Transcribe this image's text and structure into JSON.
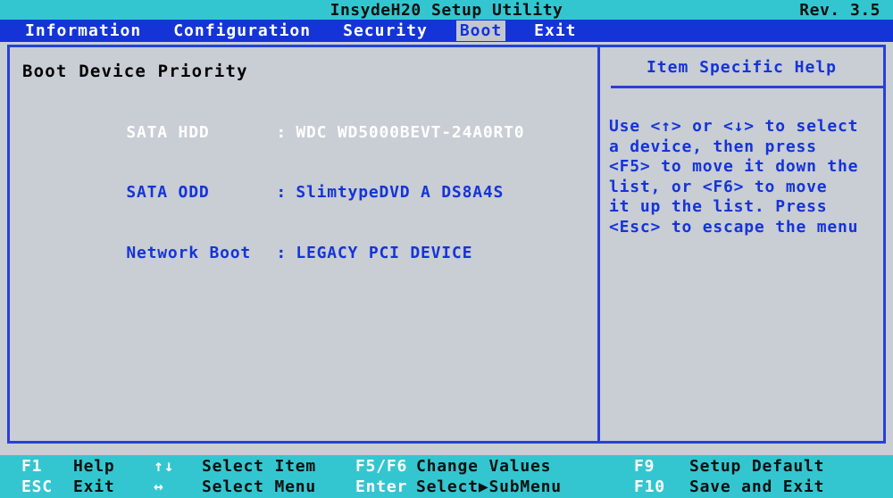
{
  "titlebar": {
    "title": "InsydeH20 Setup Utility",
    "rev": "Rev. 3.5"
  },
  "menu": {
    "items": [
      {
        "label": "Information",
        "active": false
      },
      {
        "label": "Configuration",
        "active": false
      },
      {
        "label": "Security",
        "active": false
      },
      {
        "label": "Boot",
        "active": true
      },
      {
        "label": "Exit",
        "active": false
      }
    ]
  },
  "main": {
    "section_title": "Boot Device Priority",
    "devices": [
      {
        "name": "SATA HDD",
        "colon": ":",
        "value": "WDC WD5000BEVT-24A0RT0",
        "selected": true
      },
      {
        "name": "SATA ODD",
        "colon": ":",
        "value": "SlimtypeDVD A DS8A4S",
        "selected": false
      },
      {
        "name": "Network Boot",
        "colon": ":",
        "value": "LEGACY PCI DEVICE",
        "selected": false
      }
    ]
  },
  "help": {
    "title": "Item Specific Help",
    "lines": [
      "Use <↑> or <↓> to select",
      "a device, then press",
      "<F5> to move it down the",
      "list, or <F6> to move",
      "it up the list. Press",
      "<Esc> to escape the menu"
    ]
  },
  "footer": {
    "row1": [
      {
        "key": "F1",
        "desc": "Help"
      },
      {
        "key": "↑↓",
        "desc": "Select Item"
      },
      {
        "key": "F5/F6",
        "desc": "Change Values"
      },
      {
        "key": "F9",
        "desc": "Setup Default"
      }
    ],
    "row2": [
      {
        "key": "ESC",
        "desc": "Exit"
      },
      {
        "key": "↔",
        "desc": "Select Menu"
      },
      {
        "key": "Enter",
        "desc": "Select▶SubMenu"
      },
      {
        "key": "F10",
        "desc": "Save and Exit"
      }
    ]
  },
  "colors": {
    "title_bg": "#34c6d0",
    "menu_bg": "#1434d8",
    "panel_bg": "#c9cdd4",
    "border": "#2a3fd6",
    "text_blue": "#1434d8",
    "text_white": "#ffffff",
    "footer_bg": "#34c6d0"
  }
}
